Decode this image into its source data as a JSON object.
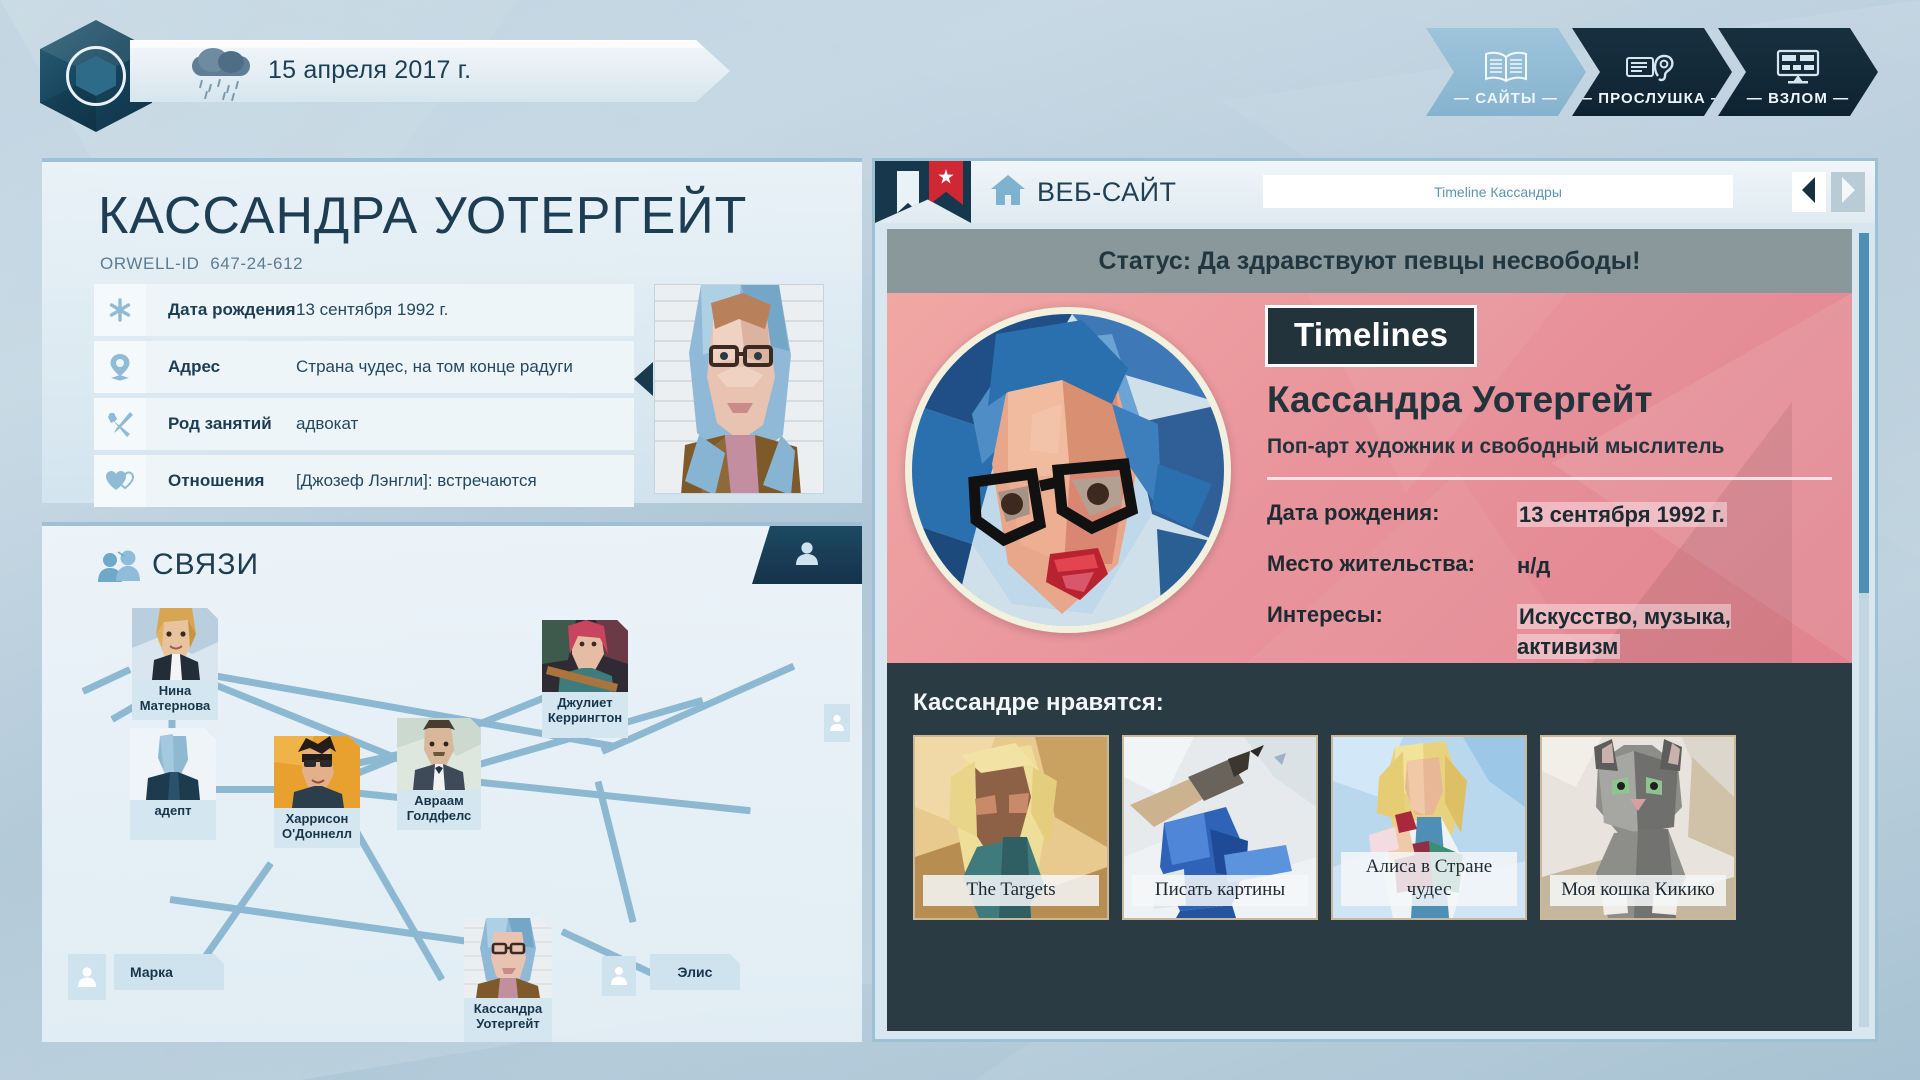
{
  "topbar": {
    "date": "15 апреля 2017 г.",
    "weather_icon": "rain-cloud-icon",
    "logo_icon": "orwell-hex-logo",
    "tabs": [
      {
        "label": "— САЙТЫ —",
        "icon": "open-book-icon",
        "active": true
      },
      {
        "label": "— ПРОСЛУШКА —",
        "icon": "ear-listening-icon",
        "active": false
      },
      {
        "label": "— ВЗЛОМ —",
        "icon": "monitor-hack-icon",
        "active": false
      }
    ]
  },
  "profile": {
    "name": "КАССАНДРА УОТЕРГЕЙТ",
    "id_label": "ORWELL-ID",
    "id_value": "647-24-612",
    "portrait_alt": "mugshot-portrait",
    "fields": [
      {
        "icon": "asterisk-icon",
        "label": "Дата рождения",
        "value": "13 сентября 1992 г."
      },
      {
        "icon": "location-pin-icon",
        "label": "Адрес",
        "value": "Страна чудес, на том конце радуги"
      },
      {
        "icon": "tools-icon",
        "label": "Род занятий",
        "value": "адвокат"
      },
      {
        "icon": "hearts-icon",
        "label": "Отношения",
        "value": "[Джозеф Лэнгли]: встречаются"
      }
    ]
  },
  "connections": {
    "title": "СВЯЗИ",
    "title_icon": "two-people-icon",
    "tab_icon": "person-icon",
    "nodes": [
      {
        "name": "Нина Матернова",
        "type": "photo"
      },
      {
        "name": "адепт",
        "type": "photo"
      },
      {
        "name": "Харрисон О'Доннелл",
        "type": "photo"
      },
      {
        "name": "Авраам Голдфелс",
        "type": "photo"
      },
      {
        "name": "Джулиет Керрингтон",
        "type": "photo"
      },
      {
        "name": "Кассандра Уотергейт",
        "type": "photo"
      },
      {
        "name": "Марка",
        "type": "pill"
      },
      {
        "name": "Элис",
        "type": "pill"
      }
    ]
  },
  "browser": {
    "title": "ВЕБ-САЙТ",
    "home_icon": "home-icon",
    "bookmark_icon": "bookmark-ribbon-icon",
    "flag_icon": "red-star-flag-icon",
    "url": "Timeline Кассандры",
    "back_icon": "back-arrow-icon",
    "forward_icon": "forward-arrow-icon"
  },
  "site": {
    "status": "Статус: Да здравствуют певцы несвободы!",
    "badge": "Timelines",
    "name": "Кассандра Уотергейт",
    "role": "Поп-арт художник и свободный мыслитель",
    "fields": [
      {
        "key": "Дата рождения:",
        "value": "13 сентября 1992 г.",
        "highlighted": true
      },
      {
        "key": "Место жительства:",
        "value": "н/д",
        "highlighted": false
      },
      {
        "key": "Интересы:",
        "value": "Искусство, музыка, активизм",
        "highlighted": true
      }
    ],
    "likes_title": "Кассандре нравятся:",
    "likes": [
      {
        "caption": "The Targets"
      },
      {
        "caption": "Писать картины"
      },
      {
        "caption": "Алиса в Стране чудес"
      },
      {
        "caption": "Моя кошка Кикико"
      }
    ]
  },
  "colors": {
    "accent": "#4e8fb5",
    "dark_navy": "#17374d",
    "hero_pink": "#e9949c",
    "panel_dark": "#2b3b44",
    "flag_red": "#cf2733"
  }
}
